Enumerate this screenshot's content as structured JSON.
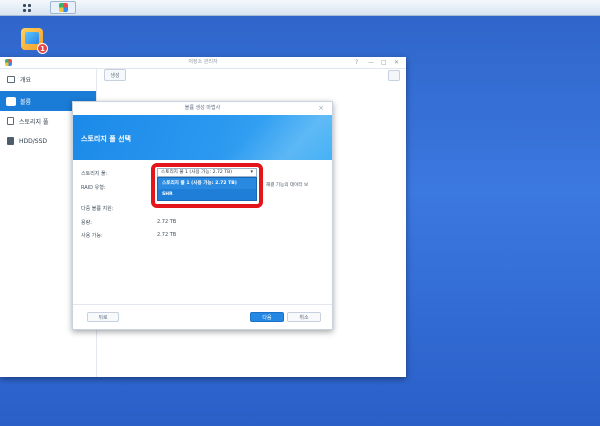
{
  "taskbar": {
    "icons": [
      "main-menu-grid-icon",
      "storage-manager-app-icon"
    ]
  },
  "desktop": {
    "icon_name": "package-center-icon",
    "badge": "1"
  },
  "window": {
    "title": "저장소 관리자",
    "controls": [
      "?",
      "—",
      "□",
      "✕"
    ],
    "sidebar": [
      {
        "label": "개요",
        "icon": "overview-icon"
      },
      {
        "label": "볼륨",
        "icon": "volume-icon"
      },
      {
        "label": "스토리지 풀",
        "icon": "storage-pool-icon"
      },
      {
        "label": "HDD/SSD",
        "icon": "hdd-icon"
      }
    ],
    "toolbar": {
      "create_label": "생성"
    }
  },
  "dialog": {
    "title": "볼륨 생성 마법사",
    "heading": "스토리지 풀 선택",
    "fields": {
      "pool_label": "스토리지 풀:",
      "pool_selected": "스토리지 풀 1 (사용 가능: 2.72 TB)",
      "raid_label": "RAID 유형:",
      "multi_volume_label": "다중 볼륨 지원:",
      "capacity_label": "용량:",
      "capacity_value": "2.72 TB",
      "available_label": "사용 가능:",
      "available_value": "2.72 TB"
    },
    "dropdown_options": [
      "스토리지 풀 1 (사용 가능: 2.72 TB)",
      "SHR"
    ],
    "side_note": "재결 기능의 데이터 보",
    "buttons": {
      "cancel_left": "뒤로",
      "next": "다음",
      "cancel": "취소"
    }
  },
  "colors": {
    "accent": "#1a7cd6",
    "highlight_frame": "#e3141a",
    "desktop": "#2f64c8"
  }
}
